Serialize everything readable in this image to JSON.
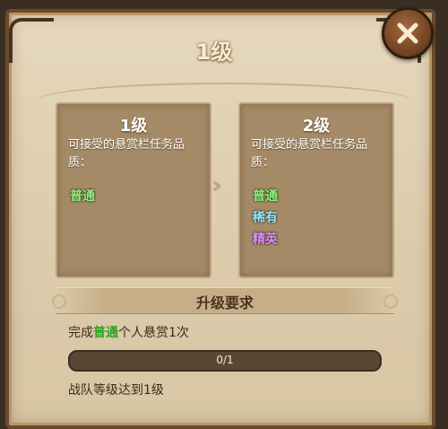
{
  "title": "1级",
  "close_icon": "close-x-icon",
  "cards": {
    "current": {
      "level": "1级",
      "label": "可接受的悬赏栏任务品质：",
      "qualities": [
        {
          "text": "普通",
          "color": "#8ef27e"
        }
      ]
    },
    "next": {
      "level": "2级",
      "label": "可接受的悬赏栏任务品质：",
      "qualities": [
        {
          "text": "普通",
          "color": "#8ef27e"
        },
        {
          "text": "稀有",
          "color": "#8fe6ff"
        },
        {
          "text": "精英",
          "color": "#dd8cff"
        }
      ]
    }
  },
  "arrow_icon": "double-chevron-right-icon",
  "requirements": {
    "title": "升级要求",
    "items": [
      {
        "pre": "完成",
        "highlight": "普通",
        "post": "个人悬赏1次",
        "progress_text": "0/1",
        "progress": 0
      },
      {
        "text": "战队等级达到1级"
      }
    ]
  }
}
